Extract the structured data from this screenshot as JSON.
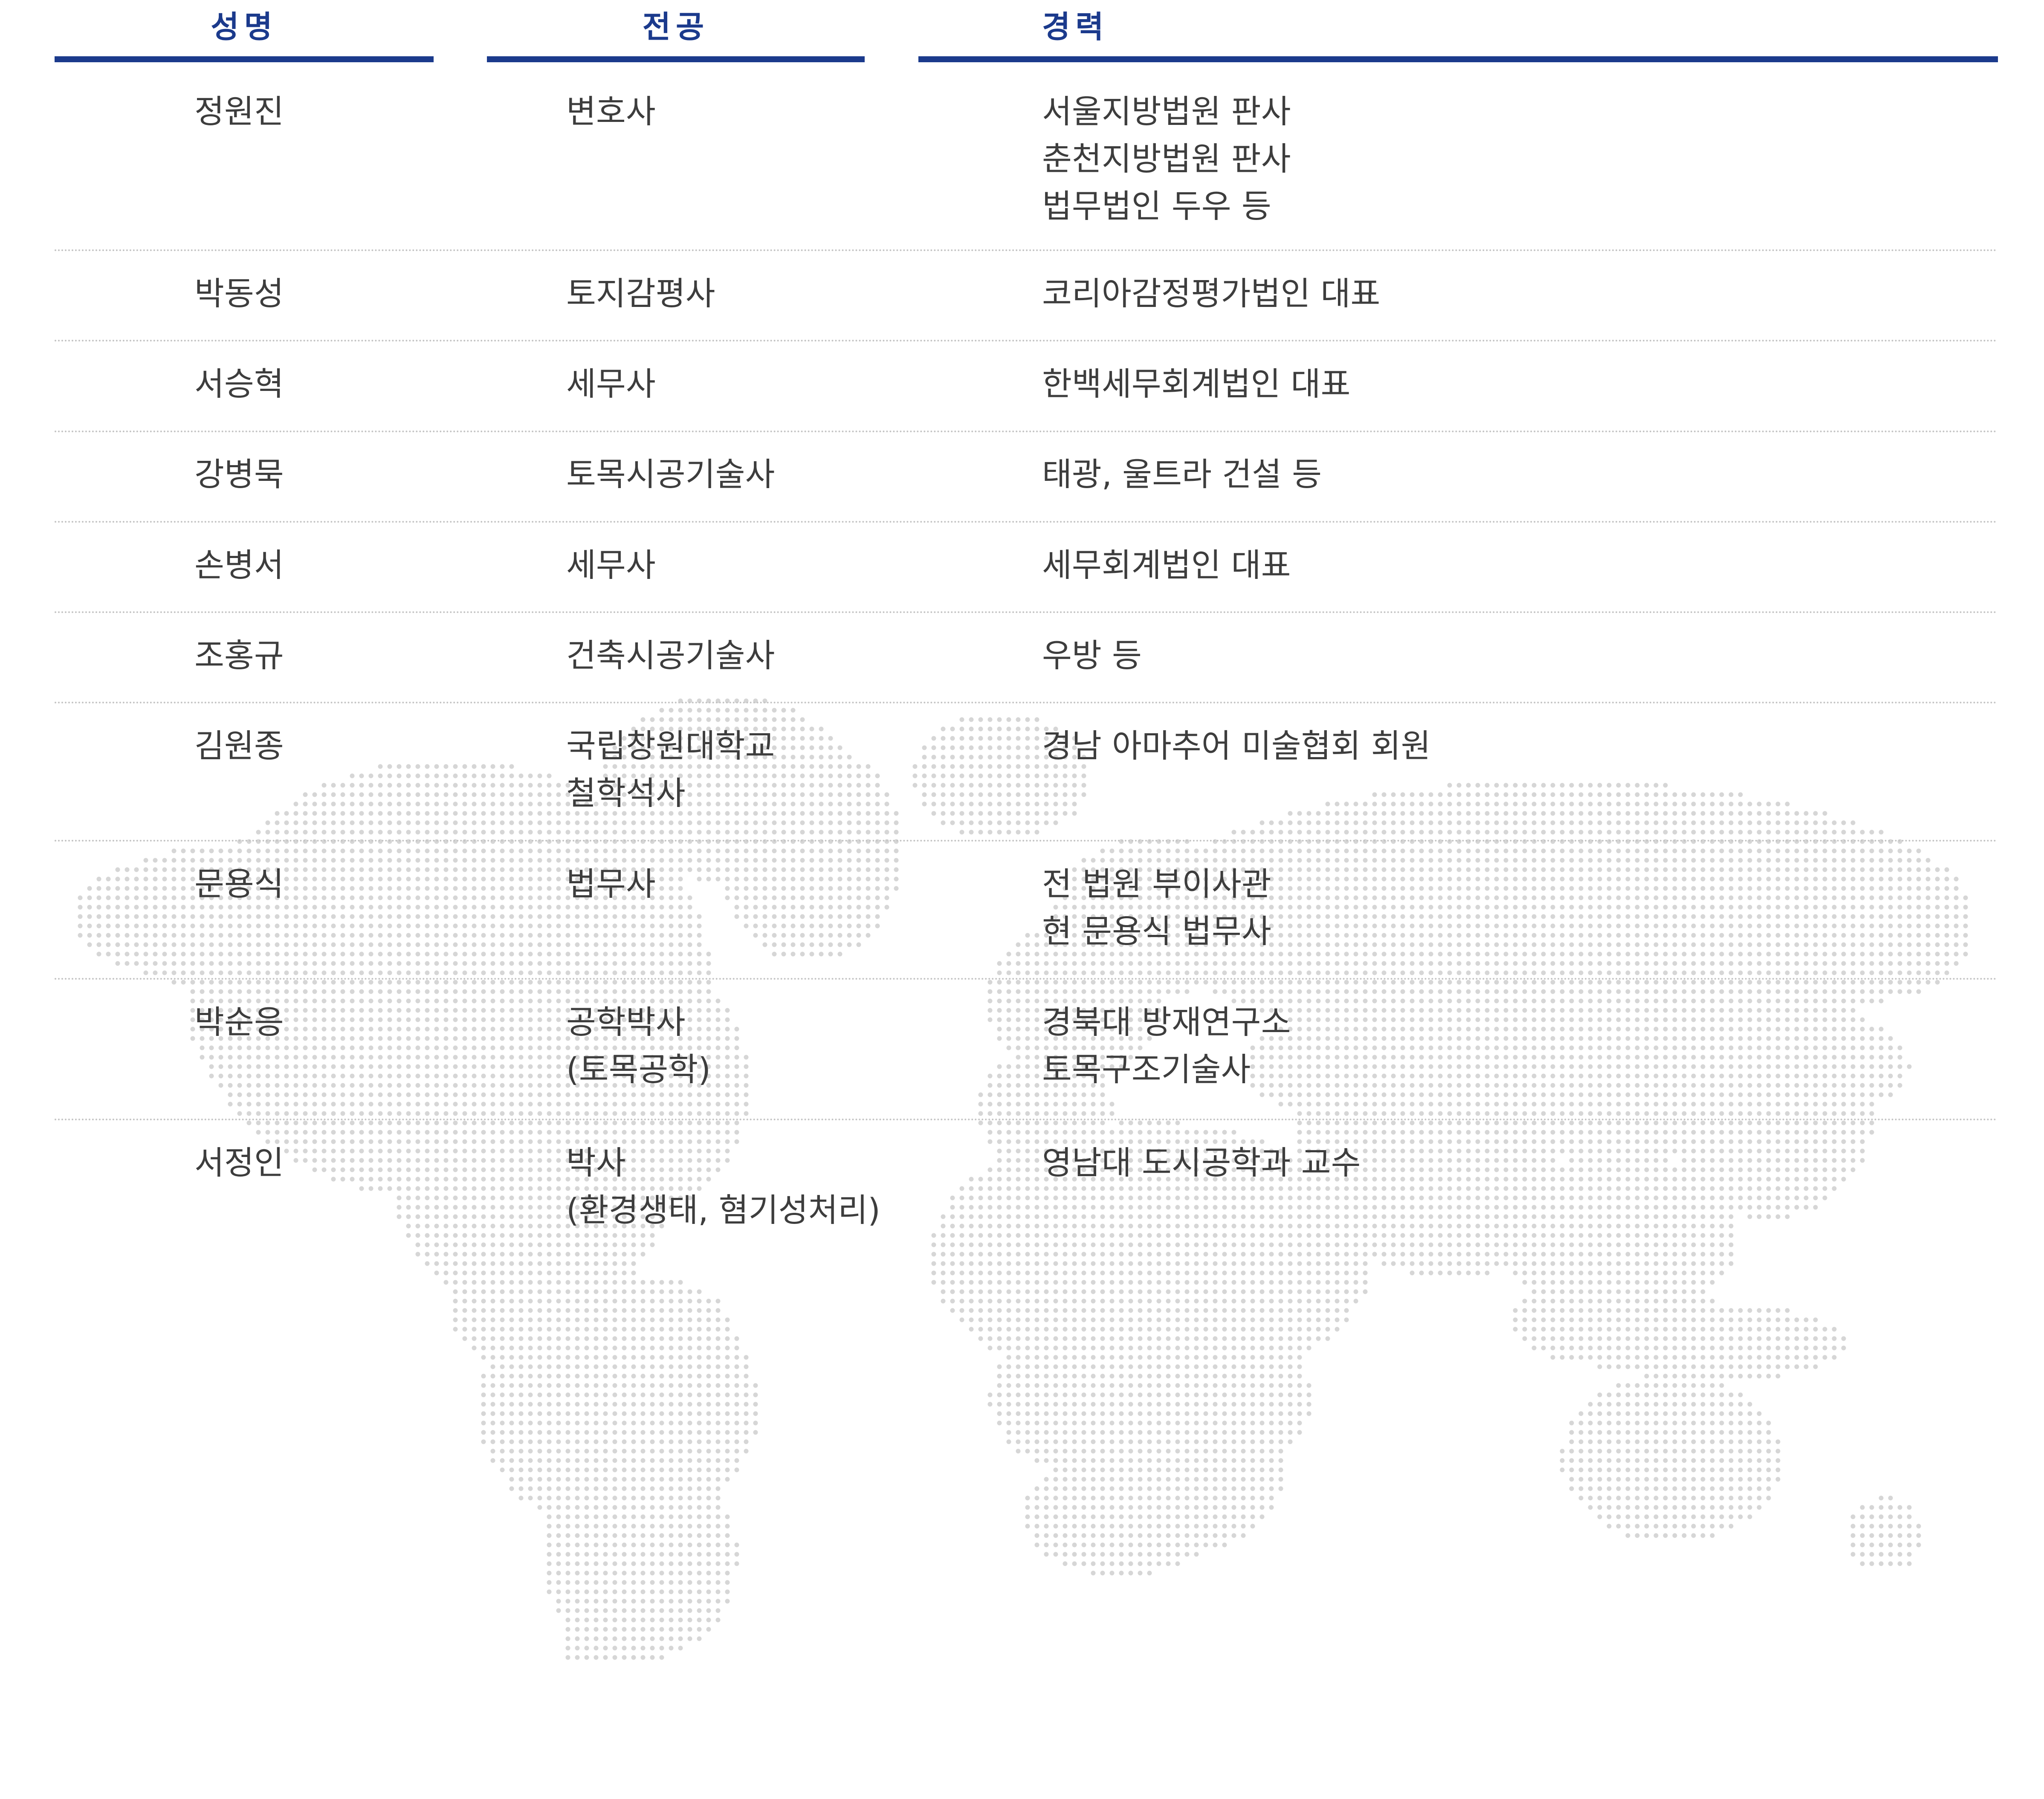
{
  "header": {
    "name": "성명",
    "major": "전공",
    "career": "경력"
  },
  "colors": {
    "header_text": "#1b3a8c",
    "header_rule": "#1b3a8c",
    "body_text": "#3d3d3d",
    "row_divider": "#c4c4c4",
    "map_dots": "#d6d6d6"
  },
  "background": {
    "icon": "dotted-world-map"
  },
  "rows": [
    {
      "name": "정원진",
      "major": "변호사",
      "career": "서울지방법원 판사\n춘천지방법원 판사\n법무법인 두우 등"
    },
    {
      "name": "박동성",
      "major": "토지감평사",
      "career": "코리아감정평가법인 대표"
    },
    {
      "name": "서승혁",
      "major": "세무사",
      "career": "한백세무회계법인 대표"
    },
    {
      "name": "강병묵",
      "major": "토목시공기술사",
      "career": "태광, 울트라 건설 등"
    },
    {
      "name": "손병서",
      "major": "세무사",
      "career": "세무회계법인 대표"
    },
    {
      "name": "조홍규",
      "major": "건축시공기술사",
      "career": "우방 등"
    },
    {
      "name": "김원종",
      "major": "국립창원대학교\n철학석사",
      "career": "경남 아마추어 미술협회 회원"
    },
    {
      "name": "문용식",
      "major": "법무사",
      "career": "전 법원 부이사관\n현 문용식 법무사"
    },
    {
      "name": "박순응",
      "major": "공학박사\n(토목공학)",
      "career": "경북대 방재연구소\n토목구조기술사"
    },
    {
      "name": "서정인",
      "major": "박사\n(환경생태, 혐기성처리)",
      "career": "영남대 도시공학과 교수"
    }
  ]
}
